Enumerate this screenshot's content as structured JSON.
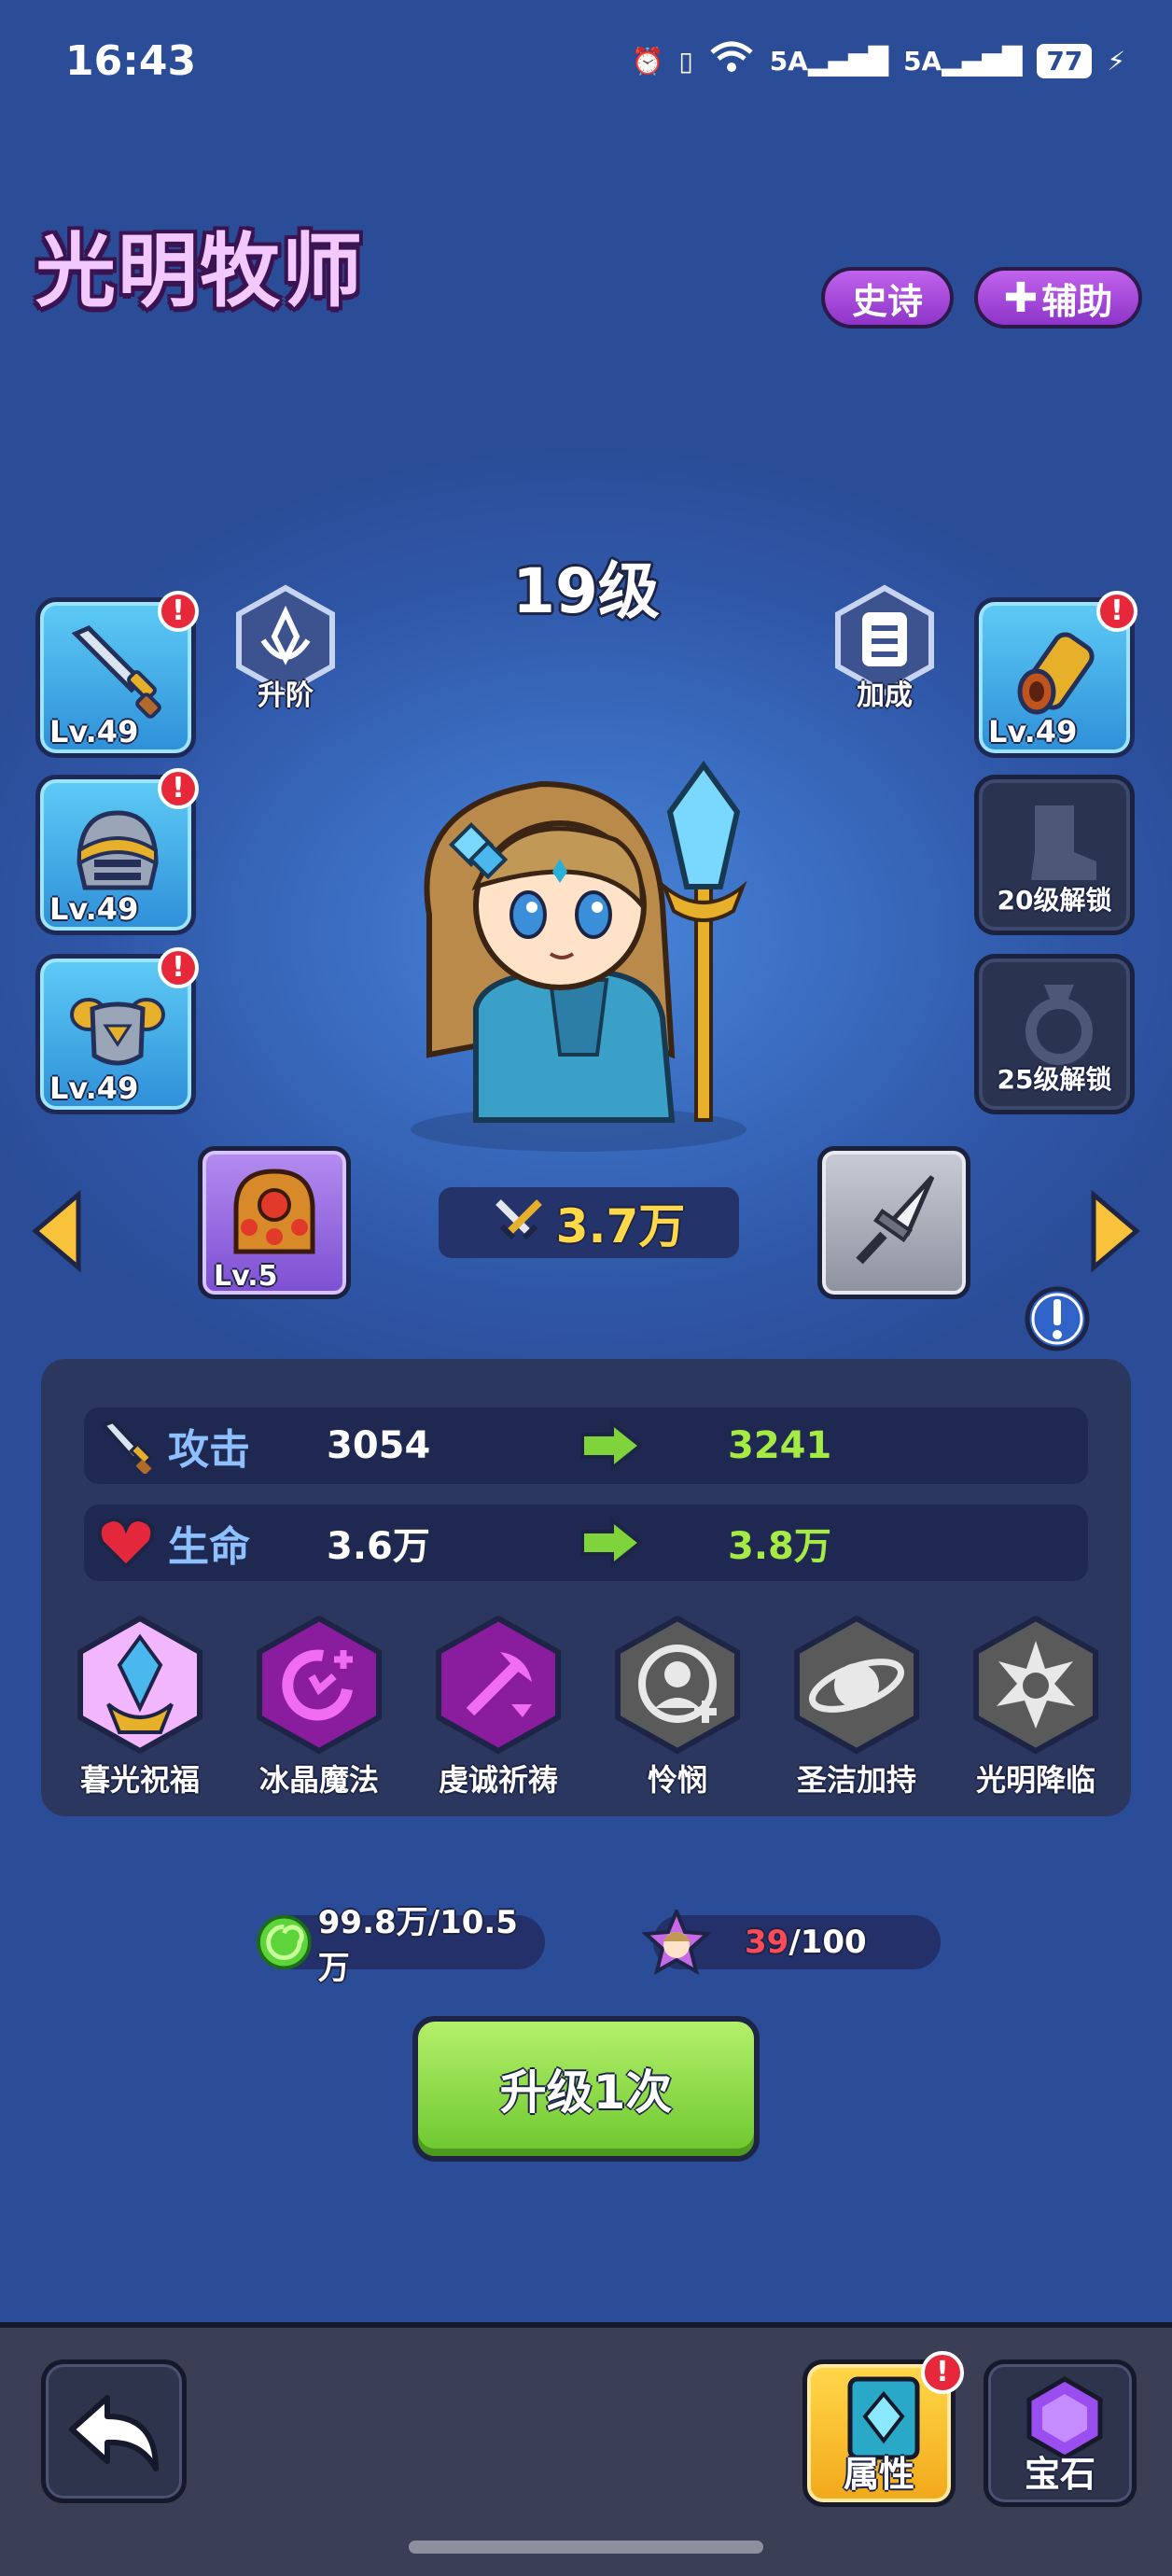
{
  "status": {
    "time": "16:43",
    "signal1": "5A",
    "signal2": "5A",
    "battery": "77"
  },
  "hero": {
    "name": "光明牧师",
    "rarity": "史诗",
    "role": "辅助",
    "level": "19级",
    "power": "3.7万"
  },
  "actions": {
    "advance": "升阶",
    "bonus": "加成"
  },
  "equipment_left": [
    {
      "name": "sword",
      "level": "Lv.49"
    },
    {
      "name": "helmet",
      "level": "Lv.49"
    },
    {
      "name": "armor",
      "level": "Lv.49"
    }
  ],
  "equipment_right": [
    {
      "name": "bracer",
      "level": "Lv.49"
    },
    {
      "name": "boots",
      "lock": "20级解锁"
    },
    {
      "name": "ring",
      "lock": "25级解锁"
    }
  ],
  "relic": {
    "level": "Lv.5"
  },
  "stats": [
    {
      "name": "攻击",
      "current": "3054",
      "next": "3241"
    },
    {
      "name": "生命",
      "current": "3.6万",
      "next": "3.8万"
    }
  ],
  "skills": [
    {
      "name": "暮光祝福",
      "color": "#f2b6ff"
    },
    {
      "name": "冰晶魔法",
      "color": "#8a1c9e"
    },
    {
      "name": "虔诚祈祷",
      "color": "#8a1c9e"
    },
    {
      "name": "怜悯",
      "color": "#5a5a5a"
    },
    {
      "name": "圣洁加持",
      "color": "#5a5a5a"
    },
    {
      "name": "光明降临",
      "color": "#5a5a5a"
    }
  ],
  "resources": {
    "gold": "99.8万/10.5万",
    "shards_have": "39",
    "shards_need": "/100"
  },
  "upgrade": {
    "label": "升级1次"
  },
  "bottom": {
    "attributes": "属性",
    "gems": "宝石"
  },
  "colors": {
    "accent_green": "#a6ea44",
    "shard_red": "#ff4a5a",
    "title_pink": "#f3c8ff"
  }
}
